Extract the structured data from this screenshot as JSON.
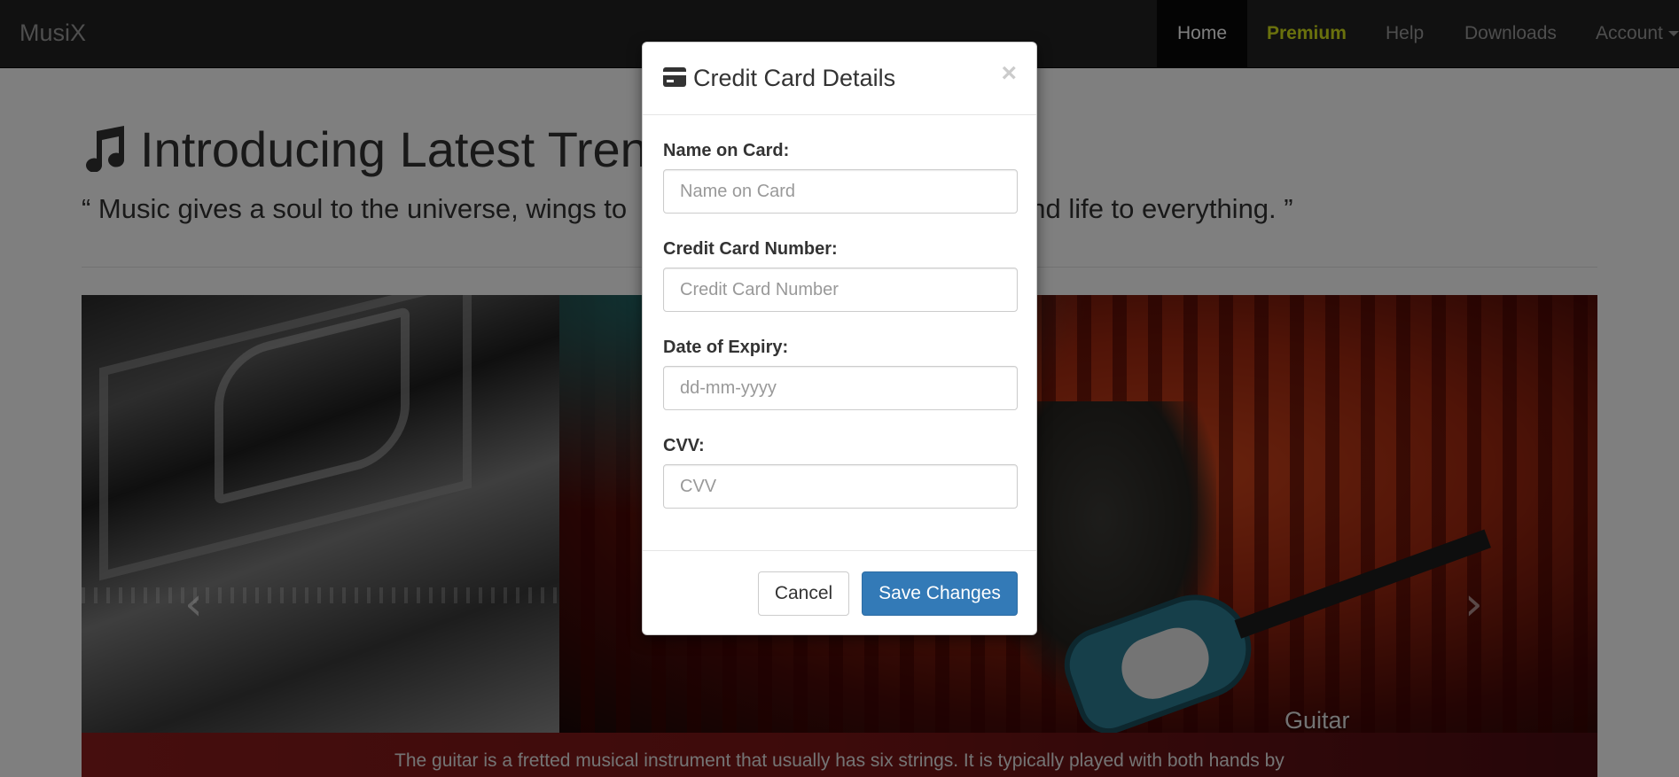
{
  "navbar": {
    "brand": "MusiX",
    "items": [
      {
        "label": "Home",
        "active": true
      },
      {
        "label": "Premium"
      },
      {
        "label": "Help"
      },
      {
        "label": "Downloads"
      },
      {
        "label": "Account"
      }
    ]
  },
  "hero": {
    "title": "Introducing Latest Trenc",
    "quote_left": "“ Music gives a soul to the universe, wings to",
    "quote_right": "n and life to everything. ”"
  },
  "carousel": {
    "slide_title": "Guitar",
    "caption": "The guitar is a fretted musical instrument that usually has six strings. It is typically played with both hands by",
    "prev_icon": "‹",
    "next_icon": "›"
  },
  "modal": {
    "title": "Credit Card Details",
    "close_label": "×",
    "fields": {
      "name": {
        "label": "Name on Card:",
        "placeholder": "Name on Card",
        "value": ""
      },
      "number": {
        "label": "Credit Card Number:",
        "placeholder": "Credit Card Number",
        "value": ""
      },
      "expiry": {
        "label": "Date of Expiry:",
        "placeholder": "dd-mm-yyyy",
        "value": ""
      },
      "cvv": {
        "label": "CVV:",
        "placeholder": "CVV",
        "value": ""
      }
    },
    "cancel_label": "Cancel",
    "save_label": "Save Changes"
  },
  "colors": {
    "navbar_bg": "#222222",
    "premium": "#d4e21a",
    "primary_button": "#337ab7"
  }
}
